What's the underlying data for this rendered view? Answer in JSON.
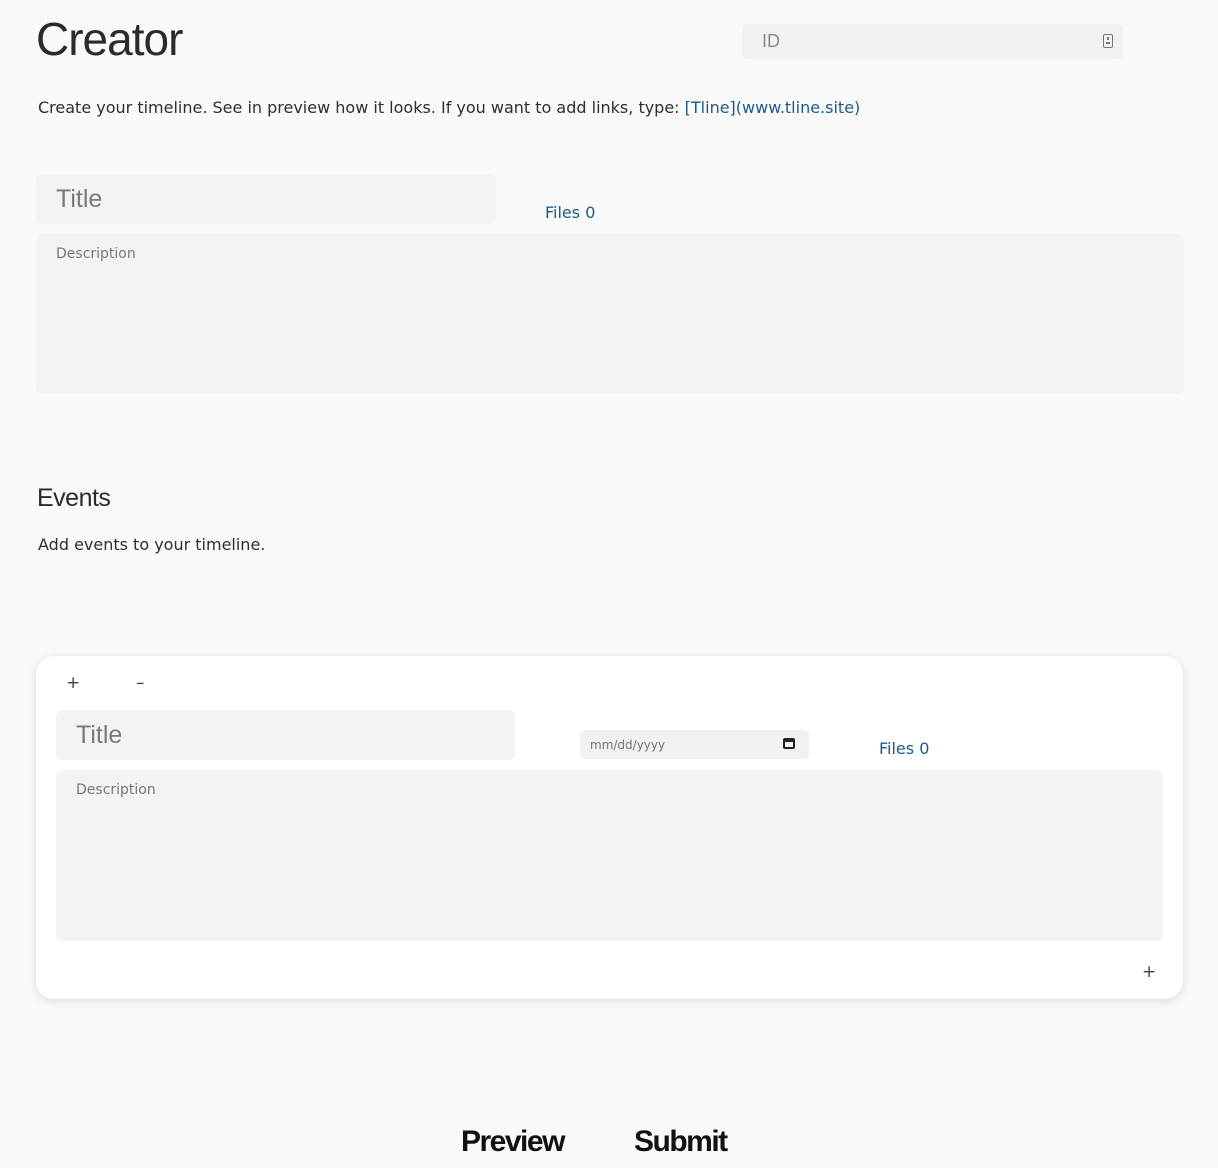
{
  "header": {
    "title": "Creator",
    "id_placeholder": "ID",
    "intro_text": "Create your timeline. See in preview how it looks. If you want to add links, type: ",
    "intro_link_example": "[Tline](www.tline.site)",
    "id_icon": "contact-card-icon"
  },
  "timeline": {
    "title_placeholder": "Title",
    "files_label": "Files 0",
    "description_placeholder": "Description"
  },
  "events": {
    "heading": "Events",
    "subtitle": "Add events to your timeline.",
    "add_symbol": "+",
    "remove_symbol": "–",
    "items": [
      {
        "title_placeholder": "Title",
        "date_placeholder": "mm/dd/yyyy",
        "files_label": "Files 0",
        "description_placeholder": "Description",
        "add_below_symbol": "+"
      }
    ]
  },
  "actions": {
    "preview_label": "Preview",
    "submit_label": "Submit"
  },
  "colors": {
    "background": "#f9f9f9",
    "field": "#f3f3f3",
    "link": "#1d5a8a",
    "card": "#ffffff"
  }
}
